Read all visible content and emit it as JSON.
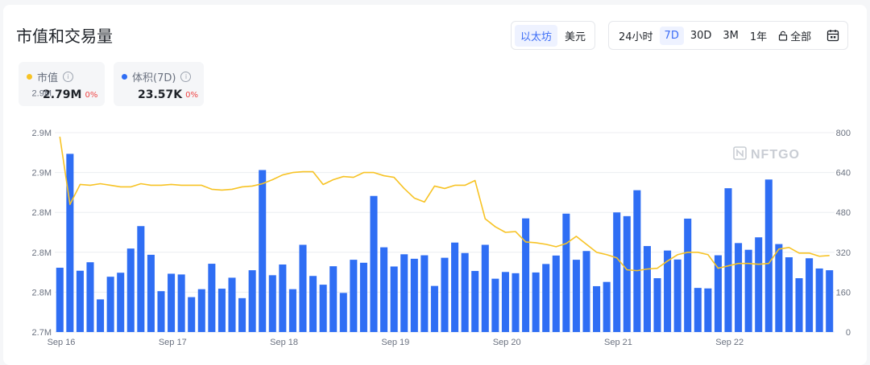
{
  "title": "市值和交易量",
  "currency_toggle": {
    "options": [
      "以太坊",
      "美元"
    ],
    "selected": "以太坊"
  },
  "time_range": {
    "options": [
      "24小时",
      "7D",
      "30D",
      "3M",
      "1年"
    ],
    "selected": "7D",
    "all_label": "全部",
    "lock_icon": "lock-icon",
    "calendar_icon": "calendar-icon"
  },
  "legend": {
    "market_cap": {
      "label": "市值",
      "value": "2.79M",
      "change": "0%",
      "color": "#f7c325",
      "icon": "ethereum-icon"
    },
    "volume": {
      "label": "体积(7D)",
      "value": "23.57K",
      "change": "0%",
      "color": "#2f6ef4",
      "icon": "ethereum-icon"
    }
  },
  "watermark": "NFTGO",
  "colors": {
    "bar": "#2f6ef4",
    "line": "#f7c325",
    "active": "#3b6cf6",
    "down": "#ef4444"
  },
  "chart_data": {
    "type": "bar",
    "x_tick_labels": [
      "Sep 16",
      "Sep 17",
      "Sep 18",
      "Sep 19",
      "Sep 20",
      "Sep 21",
      "Sep 22"
    ],
    "y_left_tick_labels": [
      "2.7M",
      "2.8M",
      "2.8M",
      "2.8M",
      "2.9M",
      "2.9M",
      "2.9M"
    ],
    "y_right_tick_labels": [
      "0",
      "160",
      "320",
      "480",
      "640",
      "800"
    ],
    "y_right_range": [
      0,
      800
    ],
    "y_left_range": [
      2.7,
      2.95
    ],
    "grid": true,
    "series": [
      {
        "name": "体积(7D)",
        "type": "bar",
        "axis": "right",
        "values": [
          258,
          715,
          246,
          280,
          131,
          222,
          238,
          335,
          425,
          310,
          164,
          234,
          231,
          140,
          172,
          274,
          174,
          218,
          136,
          248,
          650,
          228,
          271,
          172,
          350,
          225,
          190,
          264,
          157,
          290,
          278,
          546,
          340,
          263,
          312,
          294,
          308,
          185,
          298,
          359,
          317,
          245,
          350,
          214,
          241,
          236,
          456,
          239,
          273,
          307,
          475,
          290,
          325,
          184,
          201,
          480,
          465,
          569,
          345,
          216,
          327,
          291,
          455,
          177,
          175,
          308,
          577,
          357,
          330,
          380,
          612,
          353,
          300,
          216,
          296,
          255,
          248
        ]
      },
      {
        "name": "市值",
        "type": "line",
        "axis": "left",
        "values": [
          2.945,
          2.86,
          2.885,
          2.884,
          2.886,
          2.884,
          2.882,
          2.882,
          2.886,
          2.884,
          2.884,
          2.885,
          2.884,
          2.884,
          2.884,
          2.879,
          2.878,
          2.879,
          2.882,
          2.883,
          2.886,
          2.891,
          2.897,
          2.9,
          2.901,
          2.901,
          2.885,
          2.891,
          2.895,
          2.894,
          2.9,
          2.9,
          2.896,
          2.894,
          2.88,
          2.868,
          2.863,
          2.883,
          2.88,
          2.884,
          2.884,
          2.89,
          2.842,
          2.832,
          2.825,
          2.826,
          2.813,
          2.812,
          2.81,
          2.807,
          2.811,
          2.82,
          2.81,
          2.8,
          2.797,
          2.793,
          2.778,
          2.777,
          2.779,
          2.78,
          2.789,
          2.797,
          2.8,
          2.8,
          2.797,
          2.78,
          2.783,
          2.786,
          2.786,
          2.785,
          2.786,
          2.804,
          2.806,
          2.799,
          2.799,
          2.795,
          2.796
        ]
      }
    ]
  }
}
